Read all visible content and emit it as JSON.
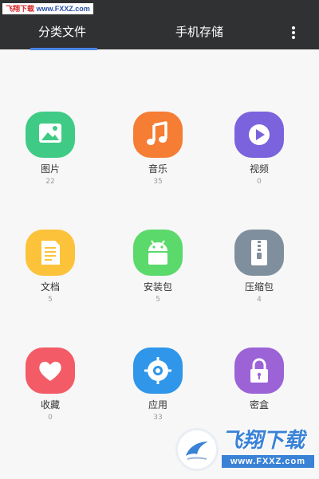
{
  "status_bar": {
    "watermark_site": "飞翔下载",
    "watermark_url": "www.FXXZ.com"
  },
  "header": {
    "tabs": [
      {
        "label": "分类文件",
        "active": true
      },
      {
        "label": "手机存储",
        "active": false
      }
    ],
    "more_icon": "more-vertical-icon",
    "background": "#2f3133",
    "accent": "#4b85e3"
  },
  "categories": [
    {
      "label": "图片",
      "count": "22",
      "icon": "image-icon",
      "color": "#3fcb86"
    },
    {
      "label": "音乐",
      "count": "35",
      "icon": "music-note-icon",
      "color": "#f57d34"
    },
    {
      "label": "视频",
      "count": "0",
      "icon": "play-icon",
      "color": "#7a63dc"
    },
    {
      "label": "文档",
      "count": "5",
      "icon": "document-icon",
      "color": "#fcc33a"
    },
    {
      "label": "安装包",
      "count": "5",
      "icon": "android-icon",
      "color": "#5bd96b"
    },
    {
      "label": "压缩包",
      "count": "4",
      "icon": "zip-icon",
      "color": "#808f9e"
    },
    {
      "label": "收藏",
      "count": "0",
      "icon": "heart-icon",
      "color": "#f35c67"
    },
    {
      "label": "应用",
      "count": "33",
      "icon": "gear-icon",
      "color": "#2f96ea"
    },
    {
      "label": "密盒",
      "count": "",
      "icon": "lock-icon",
      "color": "#9c63d6"
    }
  ],
  "watermark": {
    "title": "飞翔下载",
    "url": "www.FXXZ.com"
  }
}
